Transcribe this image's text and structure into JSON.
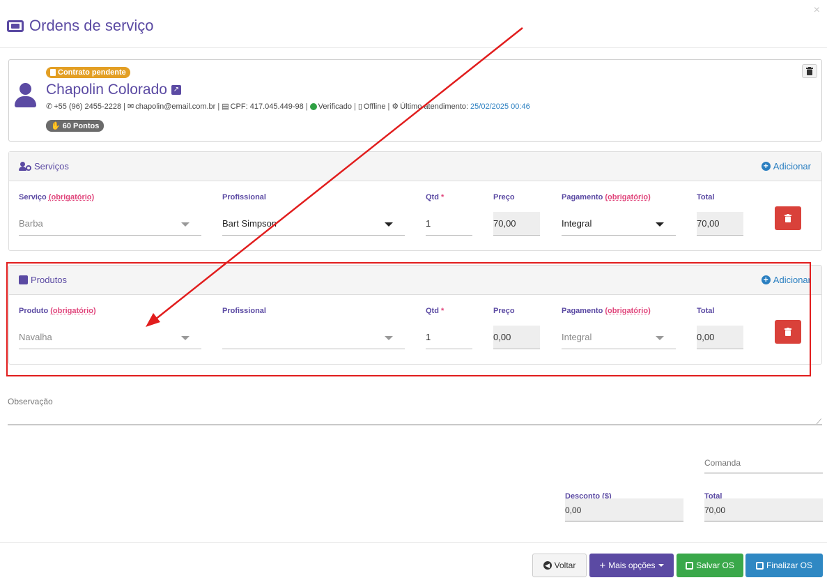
{
  "modal": {
    "title": "Ordens de serviço",
    "close": "×"
  },
  "client": {
    "contract_badge": "Contrato pendente",
    "name": "Chapolin Colorado",
    "phone": "+55 (96) 2455-2228",
    "email": "chapolin@email.com.br",
    "cpf": "CPF: 417.045.449-98",
    "verified": "Verificado",
    "status": "Offline",
    "last_visit_label": "Último atendimento:",
    "last_visit_date": "25/02/2025 00:46",
    "points": "60 Pontos",
    "sep": "|"
  },
  "services": {
    "title": "Serviços",
    "add_label": "Adicionar",
    "labels": {
      "service": "Serviço",
      "required": "(obrigatório)",
      "professional": "Profissional",
      "qty": "Qtd",
      "star": "*",
      "price": "Preço",
      "payment": "Pagamento",
      "total": "Total"
    },
    "row": {
      "service": "Barba",
      "professional": "Bart Simpson",
      "qty": "1",
      "price": "70,00",
      "payment": "Integral",
      "total": "70,00"
    }
  },
  "products": {
    "title": "Produtos",
    "add_label": "Adicionar",
    "labels": {
      "product": "Produto",
      "required": "(obrigatório)",
      "professional": "Profissional",
      "qty": "Qtd",
      "star": "*",
      "price": "Preço",
      "payment": "Pagamento",
      "total": "Total"
    },
    "row": {
      "product": "Navalha",
      "professional": "",
      "qty": "1",
      "price": "0,00",
      "payment": "Integral",
      "total": "0,00"
    }
  },
  "observation": {
    "label": "Observação"
  },
  "summary": {
    "comanda_placeholder": "Comanda",
    "discount_label": "Desconto ($)",
    "discount_value": "0,00",
    "total_label": "Total",
    "total_value": "70,00"
  },
  "buttons": {
    "back": "Voltar",
    "more": "Mais opções",
    "save": "Salvar OS",
    "finish": "Finalizar OS"
  },
  "colors": {
    "brand": "#5b4aa3",
    "link": "#2a7fc1",
    "danger": "#d9413a",
    "success": "#3aa84a",
    "info": "#2f88c3",
    "warning": "#e39f24",
    "annotation": "#e11d1d"
  }
}
